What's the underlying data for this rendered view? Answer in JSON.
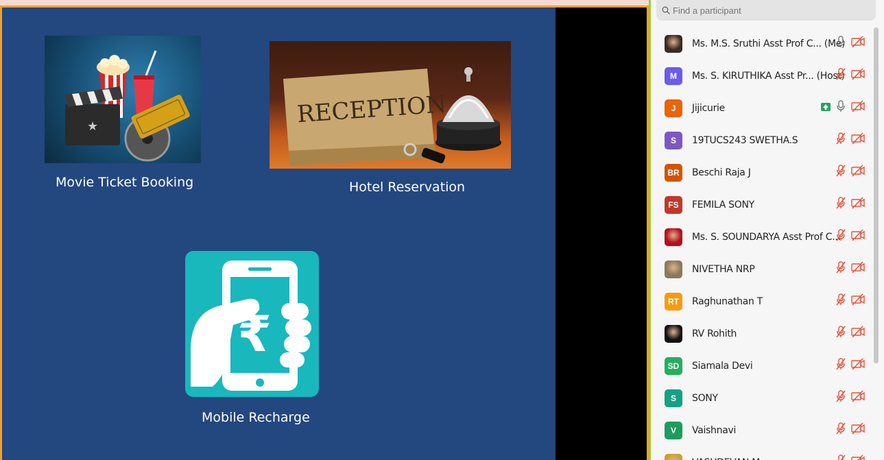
{
  "slide": {
    "items": [
      {
        "caption": "Movie Ticket Booking"
      },
      {
        "caption": "Hotel Reservation",
        "sign_text": "RECEPTION"
      },
      {
        "caption": "Mobile Recharge",
        "symbol": "₹"
      }
    ]
  },
  "panel": {
    "search_placeholder": "Find a participant",
    "participants": [
      {
        "name": "Ms. M.S. Sruthi Asst Prof C... (Me)",
        "avatar": "photo",
        "avatar_color": "#3a2a22",
        "mic": "unmuted",
        "video": "off"
      },
      {
        "name": "Ms. S. KIRUTHIKA Asst Pr... (Host)",
        "avatar": "M",
        "avatar_color": "#6c5ce7",
        "mic": "muted",
        "video": "off"
      },
      {
        "name": "Jijicurie",
        "avatar": "J",
        "avatar_color": "#e8650a",
        "mic": "unmuted",
        "video": "off",
        "share": true
      },
      {
        "name": "19TUCS243 SWETHA.S",
        "avatar": "S",
        "avatar_color": "#7e57c2",
        "mic": "muted",
        "video": "off"
      },
      {
        "name": "Beschi Raja J",
        "avatar": "BR",
        "avatar_color": "#d35400",
        "mic": "muted",
        "video": "off"
      },
      {
        "name": "FEMILA SONY",
        "avatar": "FS",
        "avatar_color": "#c0392b",
        "mic": "muted",
        "video": "off"
      },
      {
        "name": "Ms. S. SOUNDARYA Asst Prof C...",
        "avatar": "photo",
        "avatar_color": "#b3111b",
        "mic": "muted",
        "video": "off"
      },
      {
        "name": "NIVETHA NRP",
        "avatar": "photo",
        "avatar_color": "#8a7a5a",
        "mic": "muted",
        "video": "off"
      },
      {
        "name": "Raghunathan T",
        "avatar": "RT",
        "avatar_color": "#f39c12",
        "mic": "muted",
        "video": "off"
      },
      {
        "name": "RV Rohith",
        "avatar": "photo",
        "avatar_color": "#111111",
        "mic": "muted",
        "video": "off"
      },
      {
        "name": "Siamala Devi",
        "avatar": "SD",
        "avatar_color": "#27ae60",
        "mic": "muted",
        "video": "off"
      },
      {
        "name": "SONY",
        "avatar": "S",
        "avatar_color": "#16a085",
        "mic": "muted",
        "video": "off"
      },
      {
        "name": "Vaishnavi",
        "avatar": "V",
        "avatar_color": "#1e9b5e",
        "mic": "muted",
        "video": "off"
      },
      {
        "name": "VASUDEVAN M",
        "avatar": "photo",
        "avatar_color": "#c9a227",
        "mic": "muted",
        "video": "off"
      }
    ]
  }
}
